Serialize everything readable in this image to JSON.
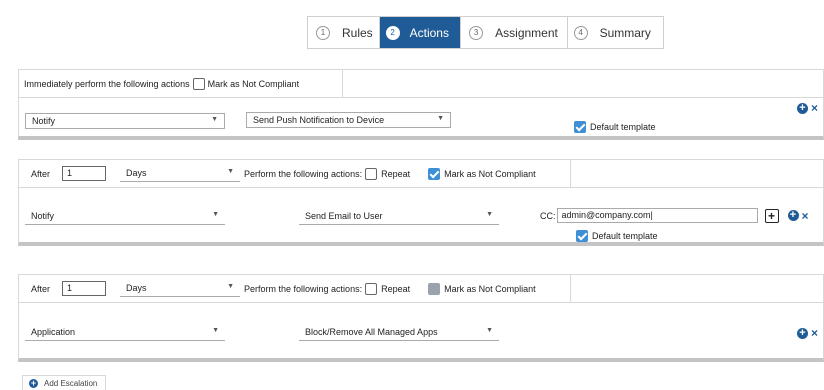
{
  "wizard": {
    "steps": [
      {
        "num": "1",
        "label": "Rules"
      },
      {
        "num": "2",
        "label": "Actions"
      },
      {
        "num": "3",
        "label": "Assignment"
      },
      {
        "num": "4",
        "label": "Summary"
      }
    ],
    "active_step": "Actions"
  },
  "panel1": {
    "tab_text": "Immediately perform the following actions",
    "mark_not_compliant": "Mark as Not Compliant",
    "action_type": "Notify",
    "action_value": "Send Push Notification to Device",
    "default_template": "Default template"
  },
  "panel2": {
    "after_label": "After",
    "after_value": "1",
    "unit": "Days",
    "perform_label": "Perform the following actions:",
    "repeat_label": "Repeat",
    "mark_not_compliant": "Mark as Not Compliant",
    "action_type": "Notify",
    "action_value": "Send Email to User",
    "cc_label": "CC:",
    "cc_value": "admin@company.com|",
    "default_template": "Default template"
  },
  "panel3": {
    "after_label": "After",
    "after_value": "1",
    "unit": "Days",
    "perform_label": "Perform the following actions:",
    "repeat_label": "Repeat",
    "mark_not_compliant": "Mark as Not Compliant",
    "action_type": "Application",
    "action_value": "Block/Remove All Managed Apps"
  },
  "add_escalation": "Add Escalation",
  "colors": {
    "accent": "#1f5c97",
    "checkbox_on": "#3d8fd6"
  }
}
